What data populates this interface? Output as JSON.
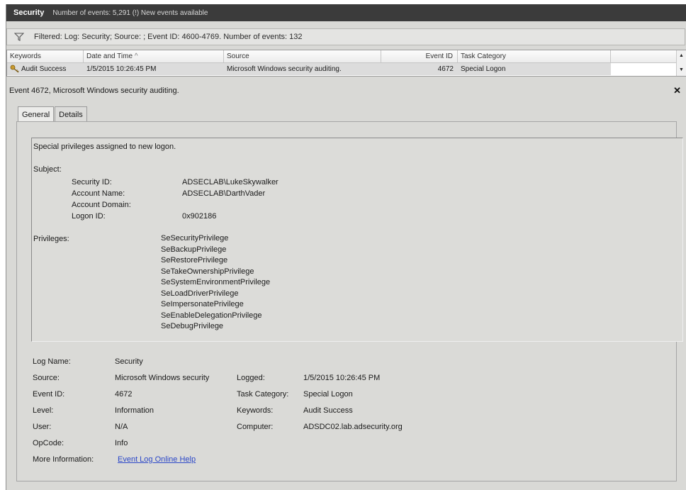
{
  "header": {
    "log_name": "Security",
    "events_text": "Number of events: 5,291 (!) New events available"
  },
  "filter": {
    "text": "Filtered: Log: Security; Source: ; Event ID: 4600-4769. Number of events: 132"
  },
  "grid": {
    "columns": [
      "Keywords",
      "Date and Time",
      "Source",
      "Event ID",
      "Task Category"
    ],
    "sort_indicator": "^",
    "row": {
      "keywords": "Audit Success",
      "date_time": "1/5/2015 10:26:45 PM",
      "source": "Microsoft Windows security auditing.",
      "event_id": "4672",
      "task_category": "Special Logon"
    }
  },
  "detail": {
    "title": "Event 4672, Microsoft Windows security auditing.",
    "tabs": [
      "General",
      "Details"
    ],
    "message": {
      "headline": "Special privileges assigned to new logon.",
      "subject_label": "Subject:",
      "subject_fields": [
        {
          "label": "Security ID:",
          "value": "ADSECLAB\\LukeSkywalker"
        },
        {
          "label": "Account Name:",
          "value": "ADSECLAB\\DarthVader"
        },
        {
          "label": "Account Domain:",
          "value": ""
        },
        {
          "label": "Logon ID:",
          "value": "0x902186"
        }
      ],
      "privileges_label": "Privileges:",
      "privileges": [
        "SeSecurityPrivilege",
        "SeBackupPrivilege",
        "SeRestorePrivilege",
        "SeTakeOwnershipPrivilege",
        "SeSystemEnvironmentPrivilege",
        "SeLoadDriverPrivilege",
        "SeImpersonatePrivilege",
        "SeEnableDelegationPrivilege",
        "SeDebugPrivilege"
      ]
    },
    "properties": {
      "log_name_label": "Log Name:",
      "log_name": "Security",
      "source_label": "Source:",
      "source": "Microsoft Windows security",
      "logged_label": "Logged:",
      "logged": "1/5/2015 10:26:45 PM",
      "event_id_label": "Event ID:",
      "event_id": "4672",
      "task_category_label": "Task Category:",
      "task_category": "Special Logon",
      "level_label": "Level:",
      "level": "Information",
      "keywords_label": "Keywords:",
      "keywords": "Audit Success",
      "user_label": "User:",
      "user": "N/A",
      "computer_label": "Computer:",
      "computer": "ADSDC02.lab.adsecurity.org",
      "opcode_label": "OpCode:",
      "opcode": "Info",
      "more_info_label": "More Information:",
      "more_info_link": "Event Log Online Help"
    }
  },
  "colors": {
    "titlebar": "#3b3b3b",
    "panel": "#d9d9d6",
    "link": "#2b47c8"
  }
}
